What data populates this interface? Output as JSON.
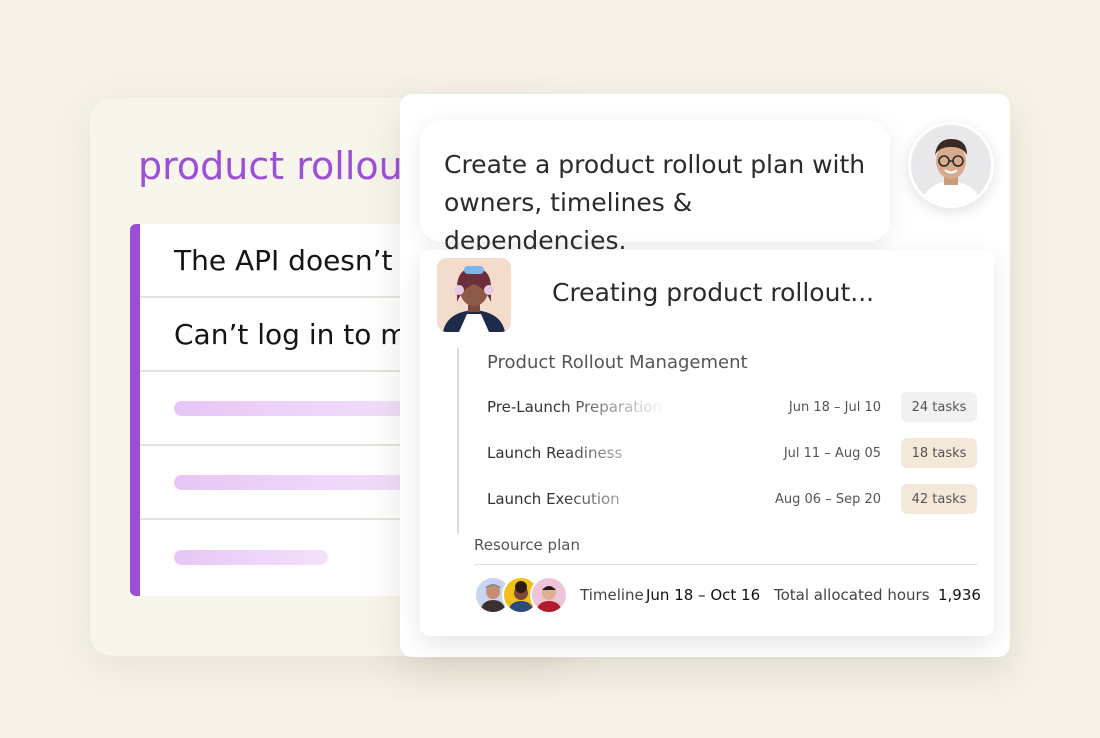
{
  "back_card": {
    "title": "product rollou",
    "rows": [
      {
        "text": "The API doesn’t w"
      },
      {
        "text": "Can’t log in to my"
      }
    ]
  },
  "prompt": {
    "line1": "Create a product rollout plan with",
    "line2": "owners, timelines & dependencies."
  },
  "assistant": {
    "status": "Creating product rollout..."
  },
  "plan": {
    "title": "Product Rollout Management",
    "phases": [
      {
        "name": "Pre-Launch Preparation",
        "dates": "Jun 18 – Jul 10",
        "tasks": "24 tasks",
        "badge_color": "#f1f1f1"
      },
      {
        "name": "Launch Readiness",
        "dates": "Jul 11 – Aug 05",
        "tasks": "18 tasks",
        "badge_color": "#f4e8d8"
      },
      {
        "name": "Launch Execution",
        "dates": "Aug 06 – Sep 20",
        "tasks": "42 tasks",
        "badge_color": "#f4e8d8"
      }
    ]
  },
  "resource": {
    "label": "Resource plan",
    "timeline_label": "Timeline",
    "timeline_value": "Jun 18 – Oct 16",
    "hours_label": "Total allocated hours",
    "hours_value": "1,936"
  },
  "colors": {
    "accent_purple": "#9d4fd8",
    "background": "#f6f2e8"
  }
}
